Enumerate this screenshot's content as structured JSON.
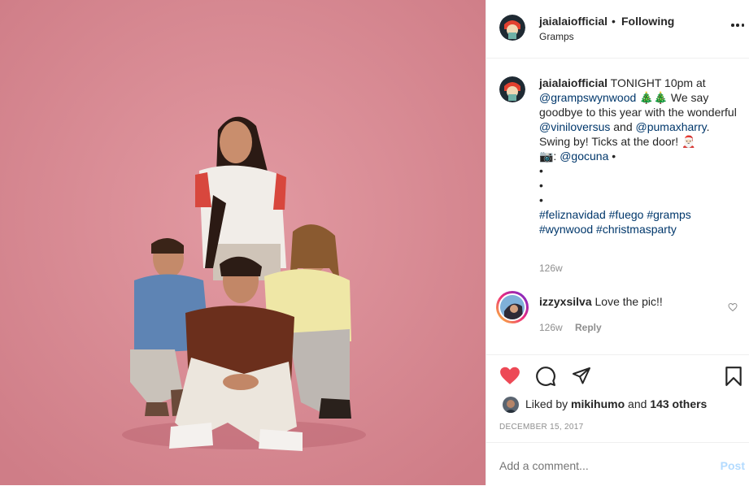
{
  "post": {
    "author": "jaialaiofficial",
    "separator": "•",
    "follow_status": "Following",
    "location": "Gramps",
    "caption": {
      "author": "jaialaiofficial",
      "text_1": " TONIGHT 10pm at ",
      "mention_1": "@grampswynwood",
      "text_2": " 🎄🎄 We say goodbye to this year with the wonderful ",
      "mention_2": "@viniloversus",
      "text_3": " and ",
      "mention_3": "@pumaxharry",
      "text_4": ". Swing by! Ticks at the door! 🎅🏻",
      "camera": "📷: ",
      "mention_4": "@gocuna",
      "text_5": " •",
      "bullet_1": "•",
      "bullet_2": "•",
      "bullet_3": "•",
      "hashtags_1": "#feliznavidad #fuego #gramps",
      "hashtags_2": "#wynwood #christmasparty",
      "age": "126w"
    },
    "comment": {
      "user": "izzyxsilva",
      "text": " Love the pic!!",
      "age": "126w",
      "reply_label": "Reply"
    },
    "likes": {
      "prefix": "Liked by ",
      "user": "mikihumo",
      "middle": " and ",
      "others": "143 others"
    },
    "date": "DECEMBER 15, 2017",
    "comment_input_placeholder": "Add a comment...",
    "post_button": "Post"
  },
  "icons": {
    "like": "heart-filled-icon",
    "comment": "comment-icon",
    "share": "share-icon",
    "save": "bookmark-icon",
    "more": "more-options-icon",
    "comment_like": "heart-outline-icon"
  },
  "colors": {
    "heart": "#ed4956",
    "mention": "#00376b",
    "muted": "#8e8e8e",
    "post_button": "#b3dbff",
    "photo_background": "#d98a93"
  }
}
